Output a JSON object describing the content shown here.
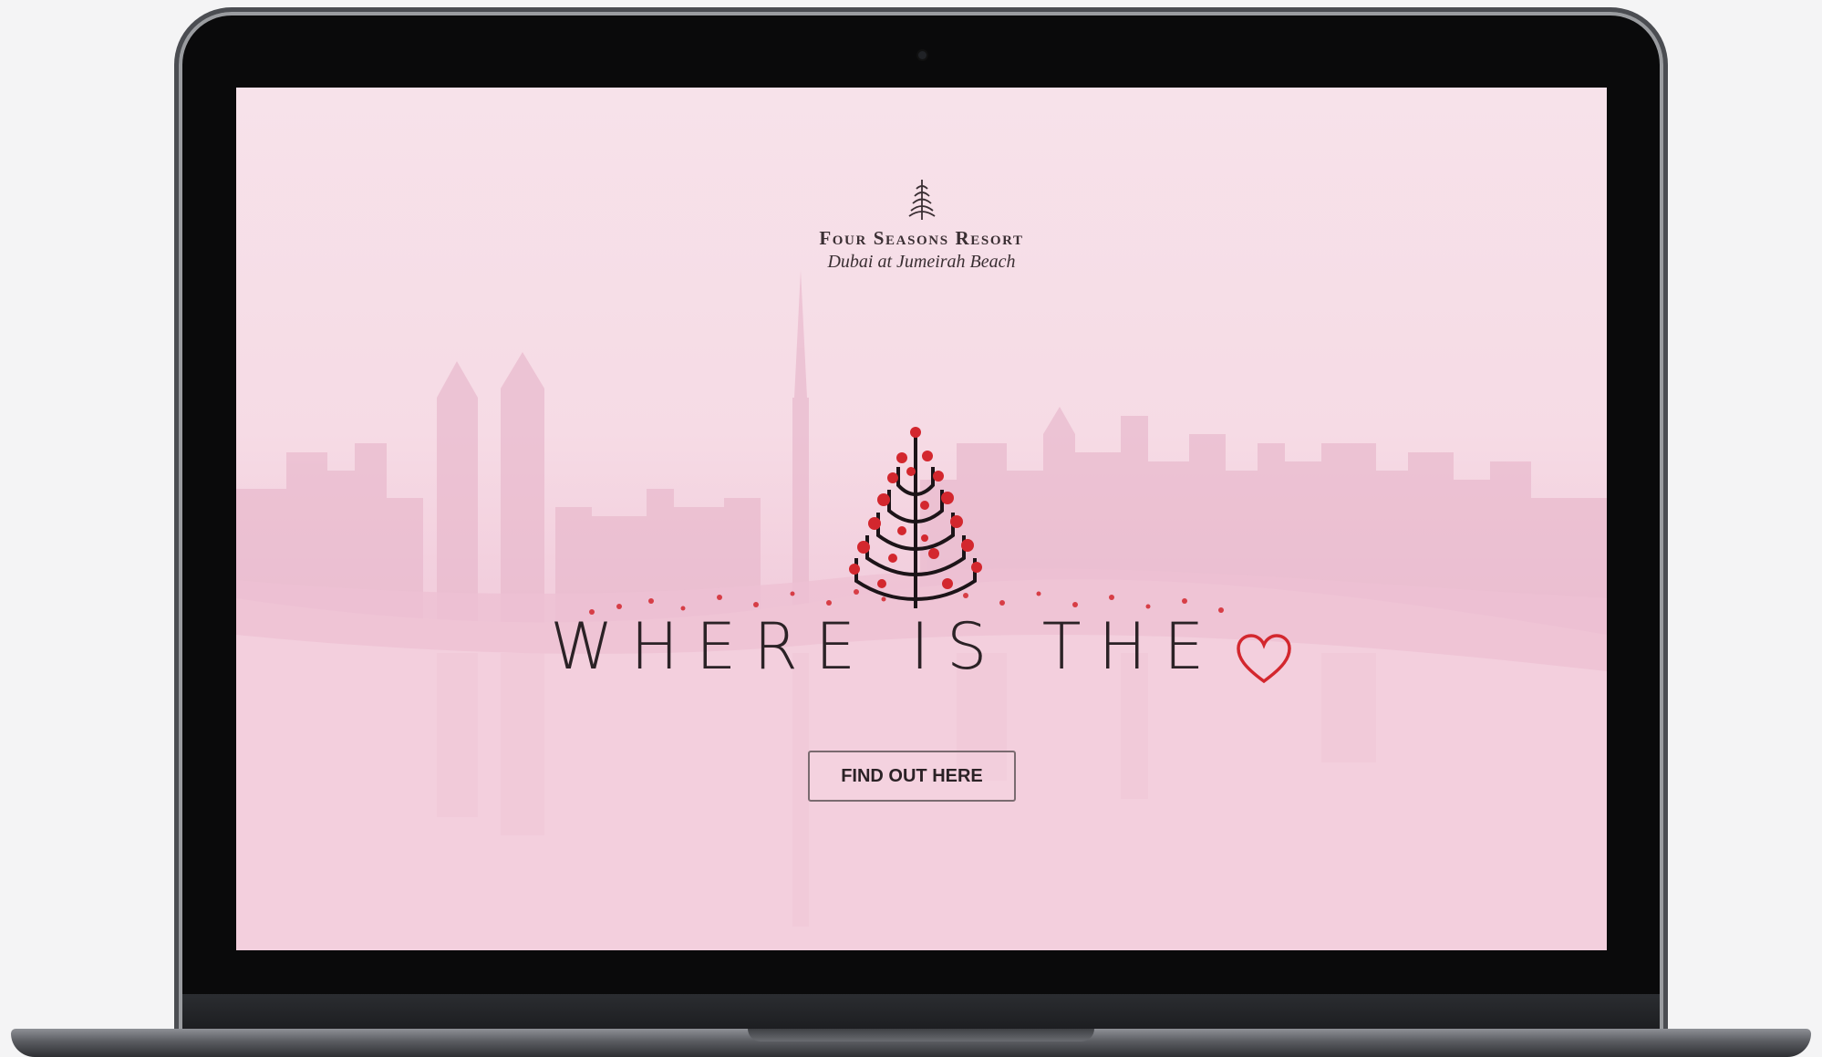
{
  "brand": {
    "name": "Four Seasons Resort",
    "subtitle": "Dubai at Jumeirah Beach"
  },
  "hero": {
    "headline": "WHERE IS THE",
    "headline_icon": "heart-outline-icon",
    "cta_label": "FIND OUT HERE"
  },
  "colors": {
    "background": "#f6dbe5",
    "accent_red": "#d3272e",
    "text_dark": "#2b2226"
  }
}
